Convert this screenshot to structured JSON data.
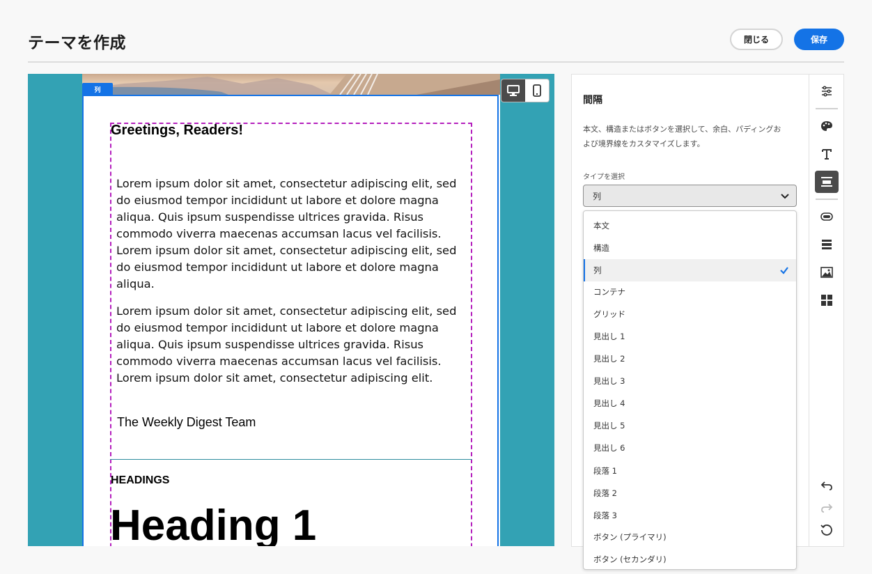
{
  "header": {
    "title": "テーマを作成",
    "close_label": "閉じる",
    "save_label": "保存"
  },
  "canvas": {
    "column_tag": "列",
    "greeting": "Greetings, Readers!",
    "paragraph1": "Lorem ipsum dolor sit amet, consectetur adipiscing elit, sed do eiusmod tempor incididunt ut labore et dolore magna aliqua. Quis ipsum suspendisse ultrices gravida. Risus commodo viverra maecenas accumsan lacus vel facilisis. Lorem ipsum dolor sit amet, consectetur adipiscing elit, sed do eiusmod tempor incididunt ut labore et dolore magna aliqua.",
    "paragraph2": "Lorem ipsum dolor sit amet, consectetur adipiscing elit, sed do eiusmod tempor incididunt ut labore et dolore magna aliqua. Quis ipsum suspendisse ultrices gravida. Risus commodo viverra maecenas accumsan lacus vel facilisis. Lorem ipsum dolor sit amet, consectetur adipiscing elit.",
    "signoff": "The Weekly Digest Team",
    "headings_label": "HEADINGS",
    "heading1": "Heading 1",
    "background_color": "#33a2b4"
  },
  "device_toggle": {
    "desktop": "desktop-icon",
    "mobile": "mobile-icon",
    "active": "desktop"
  },
  "panel": {
    "title": "間隔",
    "description": "本文、構造またはボタンを選択して、余白、パディングおよび境界線をカスタマイズします。",
    "type_label": "タイプを選択",
    "selected_value": "列"
  },
  "dropdown": {
    "options": [
      "本文",
      "構造",
      "列",
      "コンテナ",
      "グリッド",
      "見出し 1",
      "見出し 2",
      "見出し 3",
      "見出し 4",
      "見出し 5",
      "見出し 6",
      "段落 1",
      "段落 2",
      "段落 3",
      "ボタン (プライマリ)",
      "ボタン (セカンダリ)"
    ],
    "selected_index": 2
  },
  "rail": {
    "icons": [
      "settings-sliders-icon",
      "palette-icon",
      "text-icon",
      "spacing-icon",
      "button-icon",
      "structure-icon",
      "image-icon",
      "grid-icon",
      "undo-icon",
      "redo-icon",
      "reset-icon"
    ],
    "active": "spacing-icon"
  },
  "colors": {
    "accent": "#1473e6",
    "selection_outline": "#b41fbd"
  }
}
